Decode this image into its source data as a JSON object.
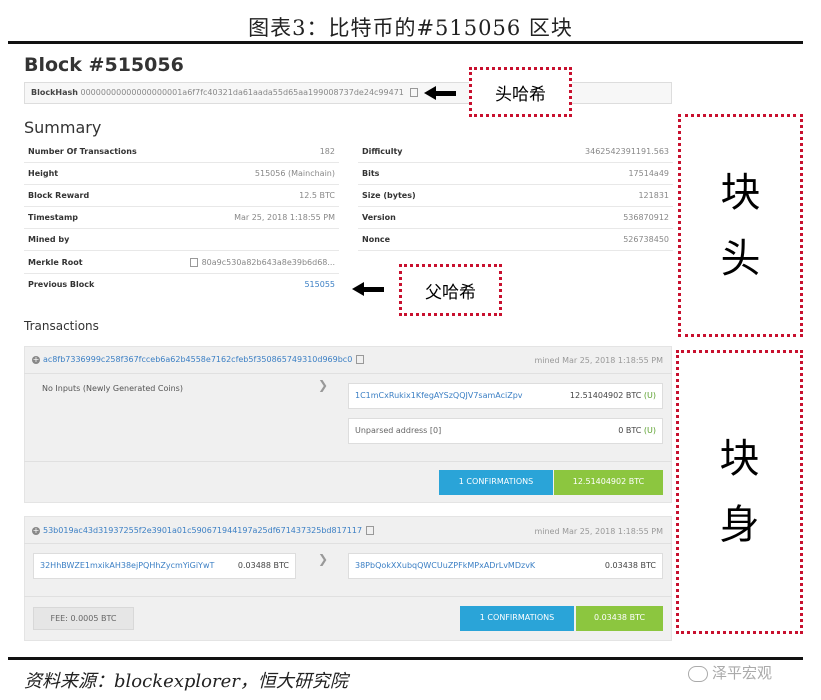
{
  "figure_title": "图表3：比特币的#515056 区块",
  "block": {
    "title": "Block #515056",
    "hash_label": "BlockHash",
    "hash_value": "00000000000000000001a6f7fc40321da61aada55d65aa199008737de24c99471"
  },
  "callouts": {
    "header_hash": "头哈希",
    "parent_hash": "父哈希",
    "block_header": [
      "块",
      "头"
    ],
    "block_body": [
      "块",
      "身"
    ]
  },
  "summary": {
    "title": "Summary",
    "left": [
      {
        "label": "Number Of Transactions",
        "value": "182"
      },
      {
        "label": "Height",
        "value": "515056 (Mainchain)"
      },
      {
        "label": "Block Reward",
        "value": "12.5 BTC"
      },
      {
        "label": "Timestamp",
        "value": "Mar 25, 2018 1:18:55 PM"
      },
      {
        "label": "Mined by",
        "value": ""
      },
      {
        "label": "Merkle Root",
        "value": "80a9c530a82b643a8e39b6d68..."
      },
      {
        "label": "Previous Block",
        "value": "515055"
      }
    ],
    "right": [
      {
        "label": "Difficulty",
        "value": "3462542391191.563"
      },
      {
        "label": "Bits",
        "value": "17514a49"
      },
      {
        "label": "Size (bytes)",
        "value": "121831"
      },
      {
        "label": "Version",
        "value": "536870912"
      },
      {
        "label": "Nonce",
        "value": "526738450"
      }
    ]
  },
  "transactions": {
    "title": "Transactions",
    "tx1": {
      "hash": "ac8fb7336999c258f367fcceb6a62b4558e7162cfeb5f350865749310d969bc0",
      "mined": "mined Mar 25, 2018 1:18:55 PM",
      "inputs": "No Inputs (Newly Generated Coins)",
      "outputs": [
        {
          "address": "1C1mCxRukix1KfegAYSzQQJV7samAciZpv",
          "amount": "12.51404902 BTC",
          "flag": "(U)"
        },
        {
          "address": "Unparsed address [0]",
          "amount": "0 BTC",
          "flag": "(U)"
        }
      ],
      "confirmations": "1 CONFIRMATIONS",
      "total": "12.51404902 BTC"
    },
    "tx2": {
      "hash": "53b019ac43d31937255f2e3901a01c590671944197a25df671437325bd817117",
      "mined": "mined Mar 25, 2018 1:18:55 PM",
      "input": {
        "address": "32HhBWZE1mxikAH38ejPQHhZycmYiGiYwT",
        "amount": "0.03488 BTC"
      },
      "output": {
        "address": "38PbQokXXubqQWCUuZPFkMPxADrLvMDzvK",
        "amount": "0.03438 BTC",
        "flag": ""
      },
      "fee": "FEE: 0.0005 BTC",
      "confirmations": "1 CONFIRMATIONS",
      "total": "0.03438 BTC"
    }
  },
  "footer": {
    "source": "资料来源：blockexplorer，恒大研究院",
    "watermark": "泽平宏观"
  }
}
